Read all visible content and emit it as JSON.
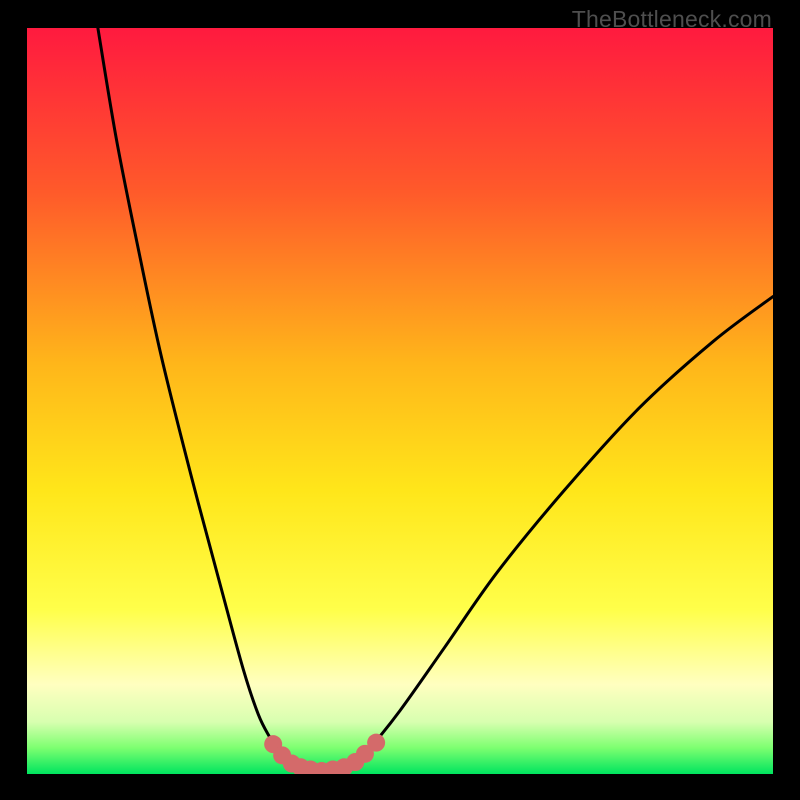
{
  "watermark": "TheBottleneck.com",
  "colors": {
    "bg_black": "#000000",
    "grad_top": "#ff1a3f",
    "grad_mid1": "#ff7a1a",
    "grad_mid2": "#ffd21a",
    "grad_mid3": "#ffff3a",
    "grad_pale": "#ffffb0",
    "grad_green_soft": "#9eff6e",
    "grad_green": "#00e55f",
    "curve_black": "#000000",
    "marker_fill": "#d46a6a",
    "marker_stroke": "#d46a6a"
  },
  "chart_data": {
    "type": "line",
    "title": "",
    "xlabel": "",
    "ylabel": "",
    "xlim": [
      0,
      100
    ],
    "ylim": [
      0,
      100
    ],
    "series": [
      {
        "name": "left-branch",
        "x": [
          9.5,
          12,
          15,
          18,
          22,
          26,
          29,
          31,
          32.5,
          33.5,
          34.5,
          35.5,
          36.7
        ],
        "y": [
          100,
          85,
          70,
          56,
          40,
          25,
          14,
          8,
          5,
          3.5,
          2.2,
          1.2,
          0.8
        ]
      },
      {
        "name": "valley-floor",
        "x": [
          36.7,
          38,
          39.5,
          41,
          42.5
        ],
        "y": [
          0.8,
          0.5,
          0.4,
          0.5,
          0.8
        ]
      },
      {
        "name": "right-branch",
        "x": [
          42.5,
          44,
          46,
          50,
          56,
          63,
          72,
          82,
          92,
          100
        ],
        "y": [
          0.8,
          1.5,
          3.5,
          8.5,
          17,
          27,
          38,
          49,
          58,
          64
        ]
      }
    ],
    "markers": {
      "name": "highlighted-range",
      "x": [
        33.0,
        34.2,
        35.5,
        36.7,
        38.0,
        39.5,
        41.0,
        42.5,
        44.0,
        45.3,
        46.8
      ],
      "y": [
        4.0,
        2.5,
        1.4,
        0.9,
        0.6,
        0.4,
        0.6,
        0.9,
        1.6,
        2.7,
        4.2
      ]
    },
    "gradient_stops": [
      {
        "offset": 0.0,
        "color": "#ff1a3f"
      },
      {
        "offset": 0.22,
        "color": "#ff5a2a"
      },
      {
        "offset": 0.45,
        "color": "#ffb61a"
      },
      {
        "offset": 0.62,
        "color": "#ffe61a"
      },
      {
        "offset": 0.78,
        "color": "#ffff4a"
      },
      {
        "offset": 0.88,
        "color": "#ffffc0"
      },
      {
        "offset": 0.93,
        "color": "#d8ffb0"
      },
      {
        "offset": 0.965,
        "color": "#7dff70"
      },
      {
        "offset": 1.0,
        "color": "#00e55f"
      }
    ]
  }
}
